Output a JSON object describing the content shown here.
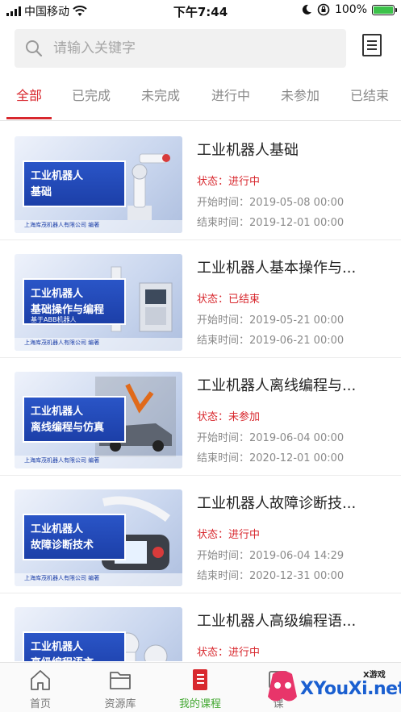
{
  "status_bar": {
    "carrier": "中国移动",
    "time": "下午7:44",
    "battery_percent": "100%",
    "battery_level": 1.0
  },
  "search": {
    "placeholder": "请输入关键字",
    "value": ""
  },
  "tabs": [
    {
      "label": "全部",
      "active": true
    },
    {
      "label": "已完成",
      "active": false
    },
    {
      "label": "未完成",
      "active": false
    },
    {
      "label": "进行中",
      "active": false
    },
    {
      "label": "未参加",
      "active": false
    },
    {
      "label": "已结束",
      "active": false
    }
  ],
  "courses": [
    {
      "title": "工业机器人基础",
      "status": "状态：进行中",
      "start": "开始时间：2019-05-08 00:00",
      "end": "结束时间：2019-12-01 00:00",
      "thumb": {
        "line1": "工业机器人",
        "line2": "基础",
        "line3": "",
        "publisher": "上海库茂机器人有限公司 编著"
      }
    },
    {
      "title": "工业机器人基本操作与...",
      "status": "状态：已结束",
      "start": "开始时间：2019-05-21 00:00",
      "end": "结束时间：2019-06-21 00:00",
      "thumb": {
        "line1": "工业机器人",
        "line2": "基础操作与编程",
        "line3": "基于ABB机器人",
        "publisher": "上海库茂机器人有限公司 编著"
      }
    },
    {
      "title": "工业机器人离线编程与...",
      "status": "状态：未参加",
      "start": "开始时间：2019-06-04 00:00",
      "end": "结束时间：2020-12-01 00:00",
      "thumb": {
        "line1": "工业机器人",
        "line2": "离线编程与仿真",
        "line3": "",
        "publisher": "上海库茂机器人有限公司 编著"
      }
    },
    {
      "title": "工业机器人故障诊断技...",
      "status": "状态：进行中",
      "start": "开始时间：2019-06-04 14:29",
      "end": "结束时间：2020-12-31 00:00",
      "thumb": {
        "line1": "工业机器人",
        "line2": "故障诊断技术",
        "line3": "",
        "publisher": "上海库茂机器人有限公司 编著"
      }
    },
    {
      "title": "工业机器人高级编程语...",
      "status": "状态：进行中",
      "start": "",
      "end": "",
      "thumb": {
        "line1": "工业机器人",
        "line2": "高级编程语言",
        "line3": "",
        "publisher": ""
      }
    }
  ],
  "bottom_nav": [
    {
      "label": "首页",
      "icon": "home-icon",
      "active": false
    },
    {
      "label": "资源库",
      "icon": "folder-icon",
      "active": false
    },
    {
      "label": "我的课程",
      "icon": "book-icon",
      "active": true
    },
    {
      "label": "课",
      "icon": "course-icon",
      "active": false
    }
  ],
  "watermark": {
    "text": "XYouXi.net",
    "small": "X游戏"
  },
  "colors": {
    "accent": "#d8282e",
    "nav_active": "#43a832",
    "muted": "#8a8a8a"
  }
}
